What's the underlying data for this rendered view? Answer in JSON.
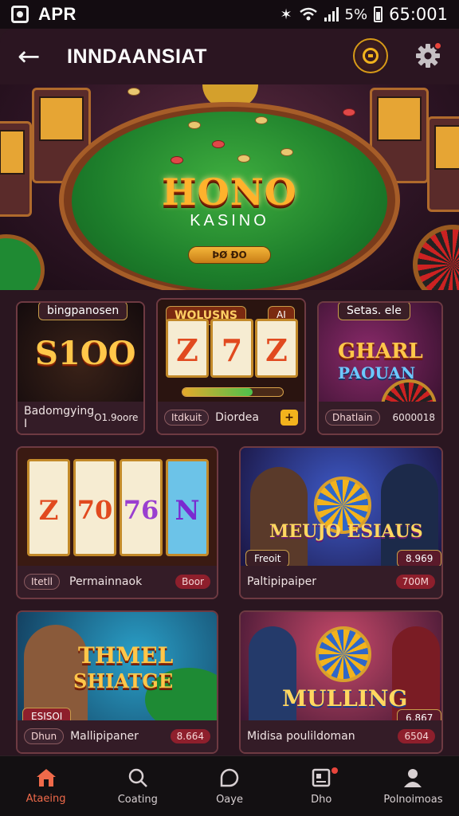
{
  "status_bar": {
    "carrier": "APR",
    "battery": "5%",
    "time": "65:001"
  },
  "app_bar": {
    "title": "INNDAANSIAT"
  },
  "hero": {
    "title": "HONO",
    "subtitle": "KASINO",
    "button_label": "ÞØ ÐO"
  },
  "cards": [
    {
      "tag": "bingpanosen",
      "headline": "S1OO",
      "footer_label": "Badomgying I",
      "footer_value": "O1.9oore"
    },
    {
      "tag": "WOLUSNS",
      "tag2": "AI",
      "reels": [
        "Z",
        "7",
        "Z"
      ],
      "footer_button": "Itdkuit",
      "footer_label": "Diordea",
      "footer_plus": "+"
    },
    {
      "tag": "Setas. ele",
      "headline1": "GHARL",
      "headline2": "PAOUAN",
      "footer_button": "Dhatlain",
      "footer_value": "6000018"
    },
    {
      "reels": [
        "Z",
        "70",
        "76",
        "N"
      ],
      "footer_button": "Itetll",
      "footer_label": "Permainnaok",
      "footer_value": "Boor"
    },
    {
      "headline": "MEUJO ESIAUS",
      "tag_left": "Freoit",
      "tag_right": "8.969",
      "footer_label": "Paltipipaiper",
      "footer_value": "700M"
    },
    {
      "headline1": "THMEL",
      "headline2": "SHIATGE",
      "tag_left": "ESISOI",
      "footer_button": "Dhun",
      "footer_label": "Mallipipaner",
      "footer_value": "8.664"
    },
    {
      "headline": "MULLING",
      "tag_right": "6.867",
      "footer_label": "Midisa poulildoman",
      "footer_value": "6504"
    }
  ],
  "nav": [
    {
      "label": "Ataeing",
      "icon": "home-icon",
      "active": true
    },
    {
      "label": "Coating",
      "icon": "search-icon"
    },
    {
      "label": "Oaye",
      "icon": "chat-icon"
    },
    {
      "label": "Dho",
      "icon": "profile-card-icon"
    },
    {
      "label": "Polnoimoas",
      "icon": "user-icon"
    }
  ],
  "colors": {
    "accent": "#f06a4a",
    "gold": "#ffc74a",
    "bg": "#2a1620"
  }
}
